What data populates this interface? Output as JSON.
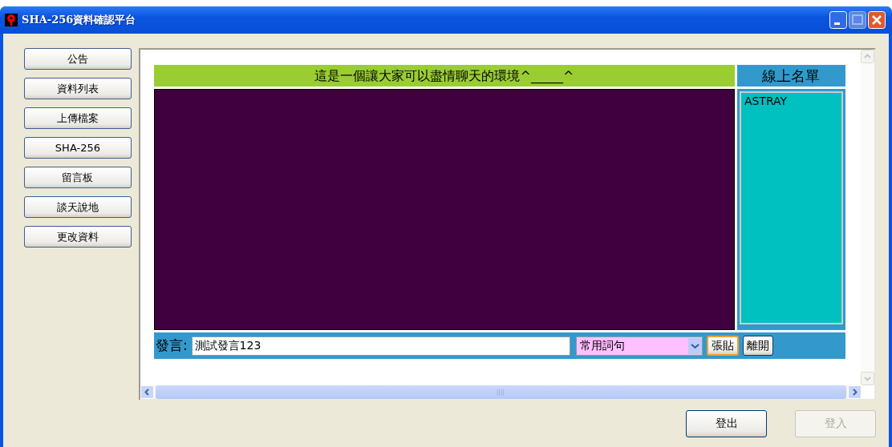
{
  "window": {
    "title": "SHA-256資料確認平台"
  },
  "nav": [
    {
      "label": "公告"
    },
    {
      "label": "資料列表"
    },
    {
      "label": "上傳檔案"
    },
    {
      "label": "SHA-256"
    },
    {
      "label": "留言板"
    },
    {
      "label": "談天說地"
    },
    {
      "label": "更改資料"
    }
  ],
  "chat": {
    "banner": "這是一個讓大家可以盡情聊天的環境^_____^",
    "online_title": "線上名單",
    "online_users": [
      "ASTRAY"
    ],
    "input_label": "發言:",
    "input_value": "測試發言123",
    "phrase_select": "常用詞句",
    "buttons": [
      {
        "label": "張貼",
        "focused": true
      },
      {
        "label": "離開",
        "focused": false
      }
    ]
  },
  "footer_buttons": [
    {
      "label": "登出",
      "disabled": false
    },
    {
      "label": "登入",
      "disabled": true
    }
  ]
}
